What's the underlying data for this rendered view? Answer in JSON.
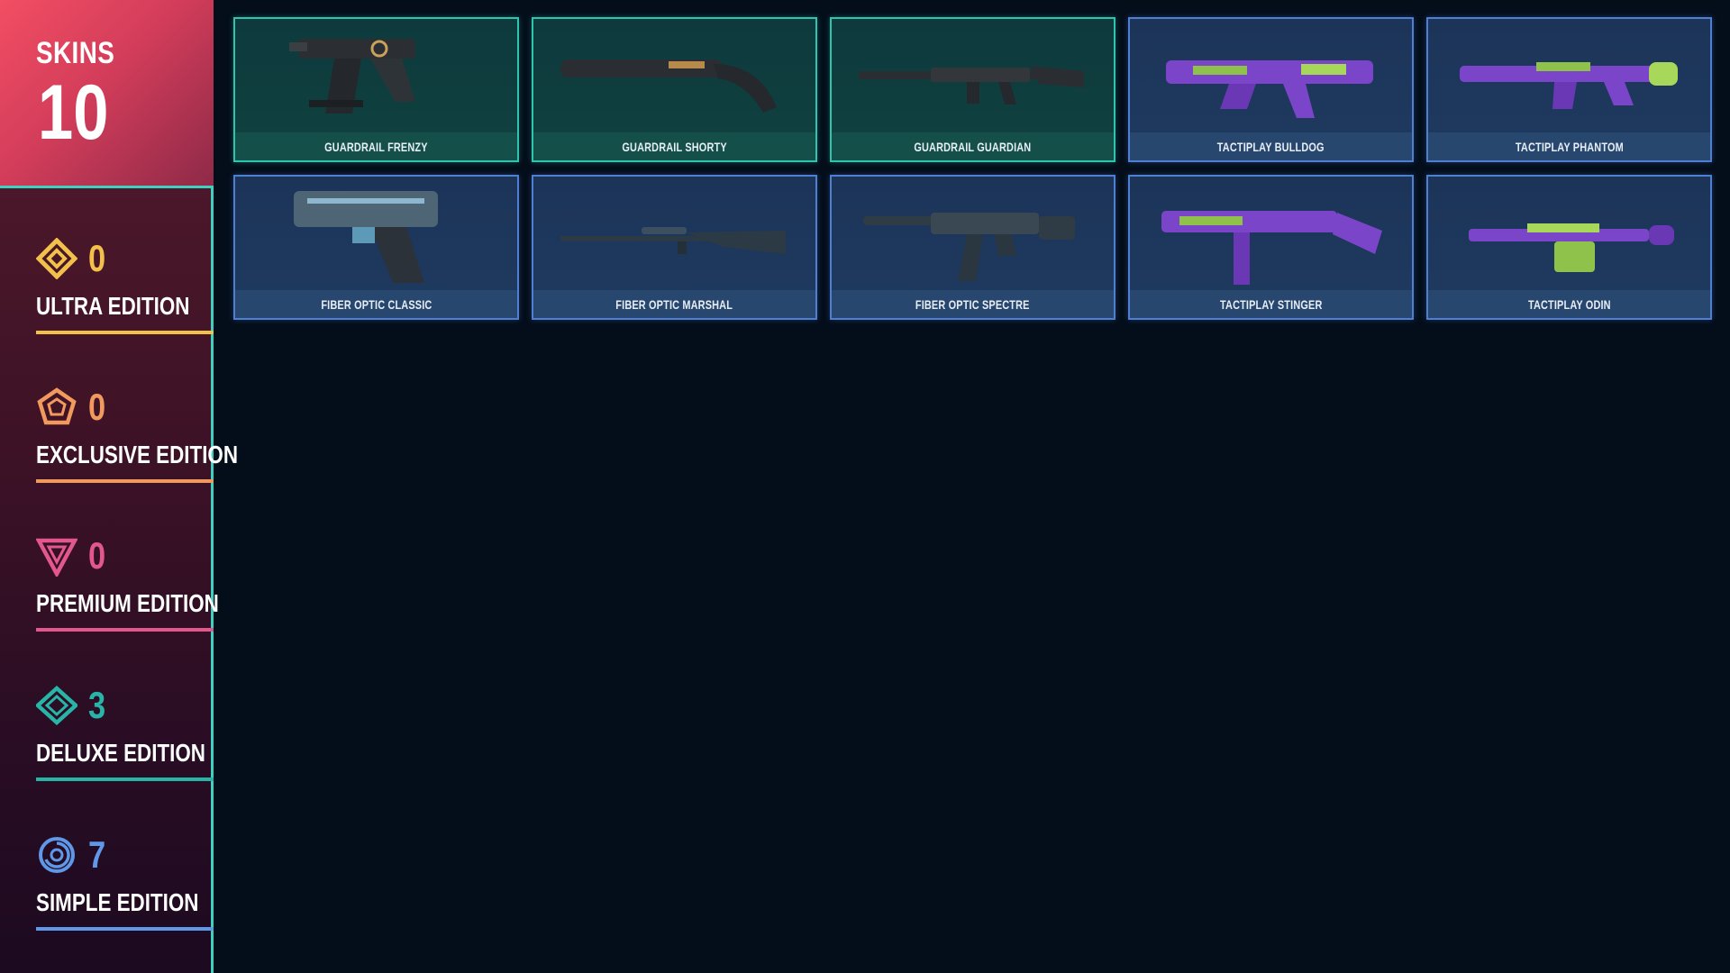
{
  "summary": {
    "label": "SKINS",
    "count": "10"
  },
  "editions": [
    {
      "count": "0",
      "label": "ULTRA EDITION",
      "color": "#f2c14a",
      "icon": "ultra-diamond-icon"
    },
    {
      "count": "0",
      "label": "EXCLUSIVE EDITION",
      "color": "#f29a5e",
      "icon": "exclusive-pentagon-icon"
    },
    {
      "count": "0",
      "label": "PREMIUM EDITION",
      "color": "#e2588d",
      "icon": "premium-triangle-icon"
    },
    {
      "count": "3",
      "label": "DELUXE EDITION",
      "color": "#26b5a6",
      "icon": "deluxe-diamond-icon"
    },
    {
      "count": "7",
      "label": "SIMPLE EDITION",
      "color": "#5f98e8",
      "icon": "simple-circle-icon"
    }
  ],
  "skins": [
    {
      "name": "GUARDRAIL FRENZY",
      "tier": "deluxe"
    },
    {
      "name": "GUARDRAIL SHORTY",
      "tier": "deluxe"
    },
    {
      "name": "GUARDRAIL GUARDIAN",
      "tier": "deluxe"
    },
    {
      "name": "TACTIPLAY BULLDOG",
      "tier": "simple"
    },
    {
      "name": "TACTIPLAY PHANTOM",
      "tier": "simple"
    },
    {
      "name": "FIBER OPTIC CLASSIC",
      "tier": "simple"
    },
    {
      "name": "FIBER OPTIC MARSHAL",
      "tier": "simple"
    },
    {
      "name": "FIBER OPTIC SPECTRE",
      "tier": "simple"
    },
    {
      "name": "TACTIPLAY STINGER",
      "tier": "simple"
    },
    {
      "name": "TACTIPLAY ODIN",
      "tier": "simple"
    }
  ],
  "colors": {
    "background": "#040e1b",
    "accent": "#3fd0bf",
    "deluxe_border": "#2ec4ad",
    "simple_border": "#4e7fd3"
  }
}
